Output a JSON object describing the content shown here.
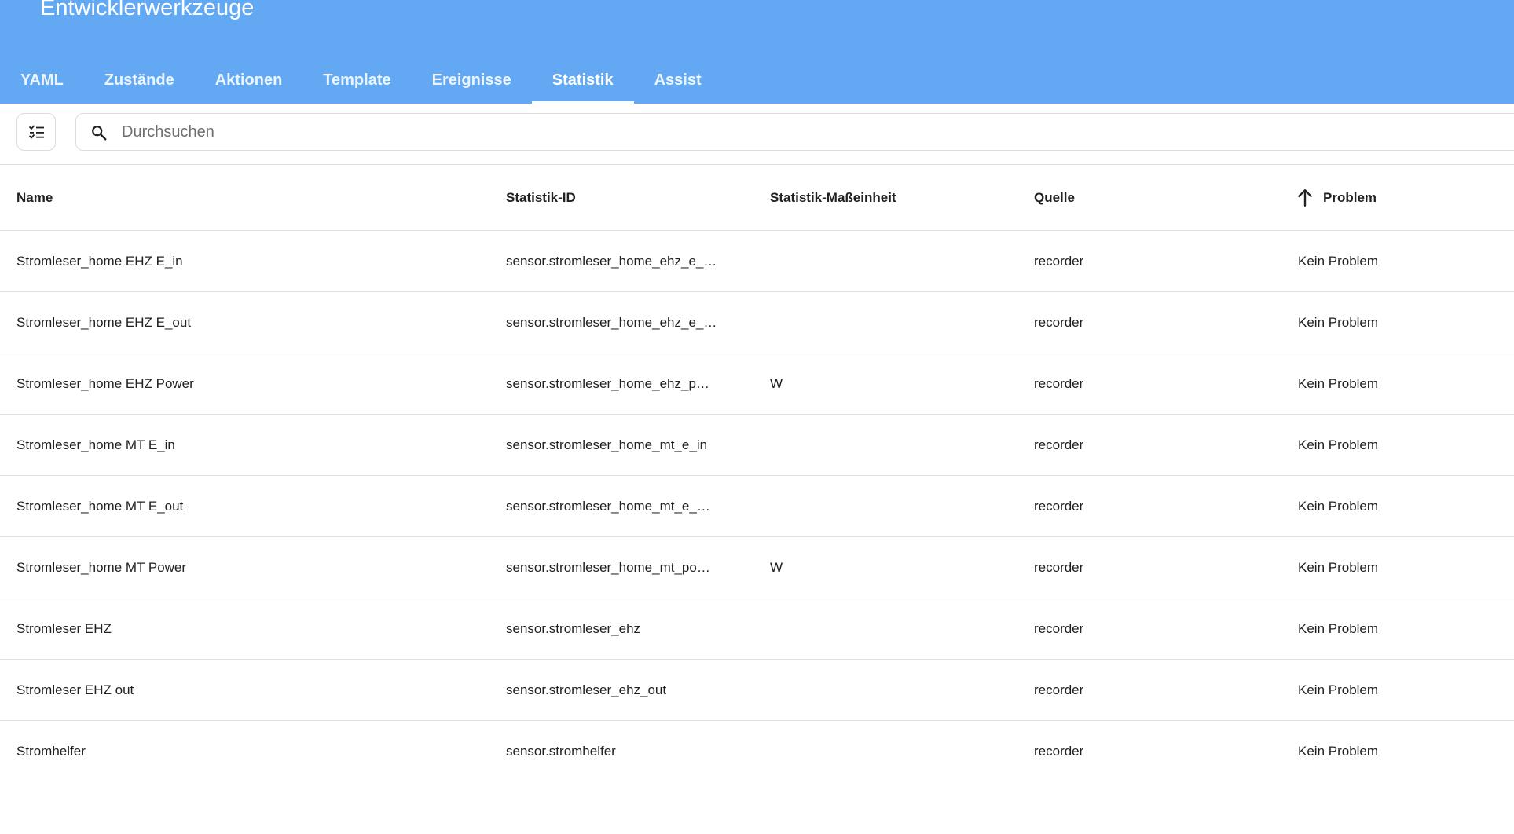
{
  "header": {
    "title": "Entwicklerwerkzeuge",
    "tabs": [
      {
        "label": "YAML",
        "active": false
      },
      {
        "label": "Zustände",
        "active": false
      },
      {
        "label": "Aktionen",
        "active": false
      },
      {
        "label": "Template",
        "active": false
      },
      {
        "label": "Ereignisse",
        "active": false
      },
      {
        "label": "Statistik",
        "active": true
      },
      {
        "label": "Assist",
        "active": false
      }
    ]
  },
  "toolbar": {
    "search_placeholder": "Durchsuchen",
    "search_value": ""
  },
  "table": {
    "columns": {
      "name": "Name",
      "statistic_id": "Statistik-ID",
      "unit": "Statistik-Maßeinheit",
      "source": "Quelle",
      "problem": "Problem"
    },
    "sort": {
      "column": "problem",
      "direction": "ascending"
    },
    "rows": [
      {
        "name": "Stromleser_home EHZ E_in",
        "statistic_id": "sensor.stromleser_home_ehz_e_…",
        "unit": "",
        "source": "recorder",
        "problem": "Kein Problem"
      },
      {
        "name": "Stromleser_home EHZ E_out",
        "statistic_id": "sensor.stromleser_home_ehz_e_…",
        "unit": "",
        "source": "recorder",
        "problem": "Kein Problem"
      },
      {
        "name": "Stromleser_home EHZ Power",
        "statistic_id": "sensor.stromleser_home_ehz_p…",
        "unit": "W",
        "source": "recorder",
        "problem": "Kein Problem"
      },
      {
        "name": "Stromleser_home MT E_in",
        "statistic_id": "sensor.stromleser_home_mt_e_in",
        "unit": "",
        "source": "recorder",
        "problem": "Kein Problem"
      },
      {
        "name": "Stromleser_home MT E_out",
        "statistic_id": "sensor.stromleser_home_mt_e_…",
        "unit": "",
        "source": "recorder",
        "problem": "Kein Problem"
      },
      {
        "name": "Stromleser_home MT Power",
        "statistic_id": "sensor.stromleser_home_mt_po…",
        "unit": "W",
        "source": "recorder",
        "problem": "Kein Problem"
      },
      {
        "name": "Stromleser EHZ",
        "statistic_id": "sensor.stromleser_ehz",
        "unit": "",
        "source": "recorder",
        "problem": "Kein Problem"
      },
      {
        "name": "Stromleser EHZ out",
        "statistic_id": "sensor.stromleser_ehz_out",
        "unit": "",
        "source": "recorder",
        "problem": "Kein Problem"
      },
      {
        "name": "Stromhelfer",
        "statistic_id": "sensor.stromhelfer",
        "unit": "",
        "source": "recorder",
        "problem": "Kein Problem"
      }
    ]
  },
  "colors": {
    "header_bg": "#62a8f2",
    "header_text": "#ffffff",
    "divider": "#e0e0e0"
  },
  "icons": {
    "filter": "filter-list-icon",
    "search": "search-icon",
    "sort": "arrow-up-icon"
  }
}
